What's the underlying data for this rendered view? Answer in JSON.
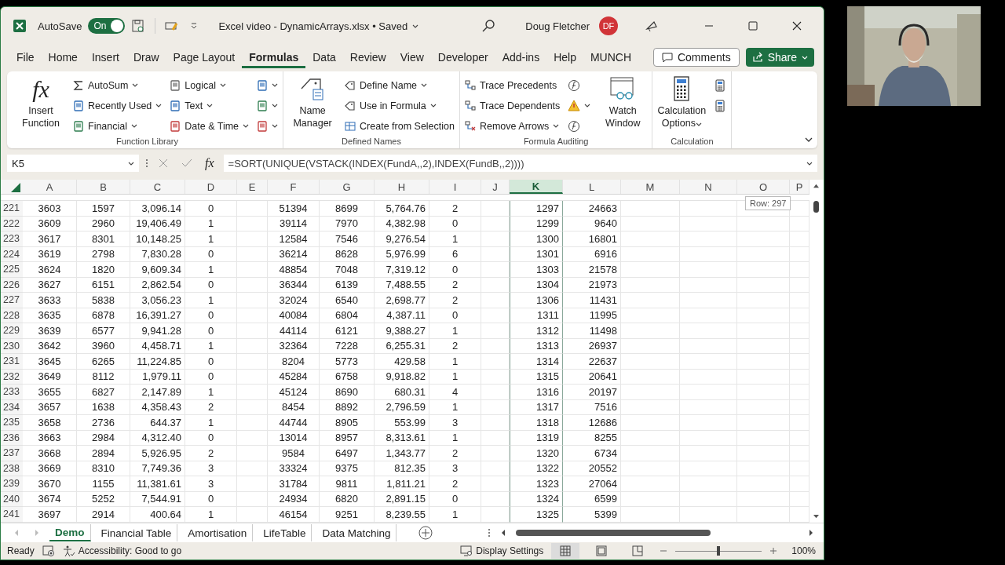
{
  "title_bar": {
    "autosave_label": "AutoSave",
    "autosave_on": true,
    "autosave_state": "On",
    "document_title": "Excel video - DynamicArrays.xlsx • Saved",
    "user_name": "Doug Fletcher",
    "user_initials": "DF"
  },
  "menu_tabs": [
    {
      "label": "File",
      "selected": false
    },
    {
      "label": "Home",
      "selected": false
    },
    {
      "label": "Insert",
      "selected": false
    },
    {
      "label": "Draw",
      "selected": false
    },
    {
      "label": "Page Layout",
      "selected": false
    },
    {
      "label": "Formulas",
      "selected": true
    },
    {
      "label": "Data",
      "selected": false
    },
    {
      "label": "Review",
      "selected": false
    },
    {
      "label": "View",
      "selected": false
    },
    {
      "label": "Developer",
      "selected": false
    },
    {
      "label": "Add-ins",
      "selected": false
    },
    {
      "label": "Help",
      "selected": false
    },
    {
      "label": "MUNCH",
      "selected": false
    }
  ],
  "comments_button": "Comments",
  "share_button": "Share",
  "ribbon": {
    "groups": [
      {
        "label": "Function Library",
        "items": [
          {
            "kind": "large",
            "label": "Insert Function",
            "icon_text": "fx",
            "dropdown": false
          },
          {
            "kind": "column",
            "buttons": [
              {
                "label": "AutoSum",
                "dropdown": true
              },
              {
                "label": "Recently Used",
                "dropdown": true
              },
              {
                "label": "Financial",
                "dropdown": true
              }
            ]
          },
          {
            "kind": "column",
            "buttons": [
              {
                "label": "Logical",
                "dropdown": true
              },
              {
                "label": "Text",
                "dropdown": true
              },
              {
                "label": "Date & Time",
                "dropdown": true
              }
            ]
          },
          {
            "kind": "column",
            "buttons": [
              {
                "dropdown": true
              },
              {
                "dropdown": true
              },
              {
                "dropdown": true
              }
            ]
          }
        ]
      },
      {
        "label": "Defined Names",
        "items": [
          {
            "kind": "large",
            "label": "Name Manager",
            "dropdown": false
          },
          {
            "kind": "column",
            "buttons": [
              {
                "label": "Define Name",
                "dropdown": true
              },
              {
                "label": "Use in Formula",
                "dropdown": true
              },
              {
                "label": "Create from Selection",
                "dropdown": false
              }
            ]
          }
        ]
      },
      {
        "label": "Formula Auditing",
        "items": [
          {
            "kind": "column",
            "buttons": [
              {
                "label": "Trace Precedents",
                "dropdown": false
              },
              {
                "label": "Trace Dependents",
                "dropdown": false
              },
              {
                "label": "Remove Arrows",
                "dropdown": true
              }
            ]
          },
          {
            "kind": "column",
            "buttons": [
              {
                "dropdown": false
              },
              {
                "dropdown": true
              },
              {
                "dropdown": false
              }
            ]
          },
          {
            "kind": "large",
            "label": "Watch Window",
            "dropdown": false
          }
        ]
      },
      {
        "label": "Calculation",
        "items": [
          {
            "kind": "large",
            "label": "Calculation Options",
            "dropdown": true
          },
          {
            "kind": "column",
            "buttons": [
              {
                "dropdown": false
              },
              {
                "dropdown": false
              }
            ]
          }
        ]
      }
    ]
  },
  "formula_bar": {
    "name_box": "K5",
    "fx_label": "fx",
    "formula": "=SORT(UNIQUE(VSTACK(INDEX(FundA,,2),INDEX(FundB,,2))))"
  },
  "sheet": {
    "columns": [
      {
        "label": "A",
        "kind": "center",
        "selected": false
      },
      {
        "label": "B",
        "kind": "center",
        "selected": false
      },
      {
        "label": "C",
        "kind": "right",
        "selected": false
      },
      {
        "label": "D",
        "kind": "center",
        "selected": false
      },
      {
        "label": "E",
        "kind": "empty",
        "selected": false
      },
      {
        "label": "F",
        "kind": "center",
        "selected": false
      },
      {
        "label": "G",
        "kind": "center",
        "selected": false
      },
      {
        "label": "H",
        "kind": "right",
        "selected": false
      },
      {
        "label": "I",
        "kind": "center",
        "selected": false
      },
      {
        "label": "J",
        "kind": "empty",
        "selected": false
      },
      {
        "label": "K",
        "kind": "right",
        "selected": true
      },
      {
        "label": "L",
        "kind": "right",
        "selected": false
      },
      {
        "label": "M",
        "kind": "empty",
        "selected": false
      },
      {
        "label": "N",
        "kind": "empty",
        "selected": false
      },
      {
        "label": "O",
        "kind": "empty",
        "selected": false
      },
      {
        "label": "P",
        "kind": "empty",
        "selected": false
      }
    ],
    "rows": [
      {
        "number": "221",
        "cells": [
          "3603",
          "1597",
          "3,096.14",
          "0",
          "",
          "51394",
          "8699",
          "5,764.76",
          "2",
          "",
          "1297",
          "24663",
          "",
          "",
          "",
          ""
        ]
      },
      {
        "number": "222",
        "cells": [
          "3609",
          "2960",
          "19,406.49",
          "1",
          "",
          "39114",
          "7970",
          "4,382.98",
          "0",
          "",
          "1299",
          "9640",
          "",
          "",
          "",
          ""
        ]
      },
      {
        "number": "223",
        "cells": [
          "3617",
          "8301",
          "10,148.25",
          "1",
          "",
          "12584",
          "7546",
          "9,276.54",
          "1",
          "",
          "1300",
          "16801",
          "",
          "",
          "",
          ""
        ]
      },
      {
        "number": "224",
        "cells": [
          "3619",
          "2798",
          "7,830.28",
          "0",
          "",
          "36214",
          "8628",
          "5,976.99",
          "6",
          "",
          "1301",
          "6916",
          "",
          "",
          "",
          ""
        ]
      },
      {
        "number": "225",
        "cells": [
          "3624",
          "1820",
          "9,609.34",
          "1",
          "",
          "48854",
          "7048",
          "7,319.12",
          "0",
          "",
          "1303",
          "21578",
          "",
          "",
          "",
          ""
        ]
      },
      {
        "number": "226",
        "cells": [
          "3627",
          "6151",
          "2,862.54",
          "0",
          "",
          "36344",
          "6139",
          "7,488.55",
          "2",
          "",
          "1304",
          "21973",
          "",
          "",
          "",
          ""
        ]
      },
      {
        "number": "227",
        "cells": [
          "3633",
          "5838",
          "3,056.23",
          "1",
          "",
          "32024",
          "6540",
          "2,698.77",
          "2",
          "",
          "1306",
          "11431",
          "",
          "",
          "",
          ""
        ]
      },
      {
        "number": "228",
        "cells": [
          "3635",
          "6878",
          "16,391.27",
          "0",
          "",
          "40084",
          "6804",
          "4,387.11",
          "0",
          "",
          "1311",
          "11995",
          "",
          "",
          "",
          ""
        ]
      },
      {
        "number": "229",
        "cells": [
          "3639",
          "6577",
          "9,941.28",
          "0",
          "",
          "44114",
          "6121",
          "9,388.27",
          "1",
          "",
          "1312",
          "11498",
          "",
          "",
          "",
          ""
        ]
      },
      {
        "number": "230",
        "cells": [
          "3642",
          "3960",
          "4,458.71",
          "1",
          "",
          "32364",
          "7228",
          "6,255.31",
          "2",
          "",
          "1313",
          "26937",
          "",
          "",
          "",
          ""
        ]
      },
      {
        "number": "231",
        "cells": [
          "3645",
          "6265",
          "11,224.85",
          "0",
          "",
          "8204",
          "5773",
          "429.58",
          "1",
          "",
          "1314",
          "22637",
          "",
          "",
          "",
          ""
        ]
      },
      {
        "number": "232",
        "cells": [
          "3649",
          "8112",
          "1,979.11",
          "0",
          "",
          "45284",
          "6758",
          "9,918.82",
          "1",
          "",
          "1315",
          "20641",
          "",
          "",
          "",
          ""
        ]
      },
      {
        "number": "233",
        "cells": [
          "3655",
          "6827",
          "2,147.89",
          "1",
          "",
          "45124",
          "8690",
          "680.31",
          "4",
          "",
          "1316",
          "20197",
          "",
          "",
          "",
          ""
        ]
      },
      {
        "number": "234",
        "cells": [
          "3657",
          "1638",
          "4,358.43",
          "2",
          "",
          "8454",
          "8892",
          "2,796.59",
          "1",
          "",
          "1317",
          "7516",
          "",
          "",
          "",
          ""
        ]
      },
      {
        "number": "235",
        "cells": [
          "3658",
          "2736",
          "644.37",
          "1",
          "",
          "44744",
          "8905",
          "553.99",
          "3",
          "",
          "1318",
          "12686",
          "",
          "",
          "",
          ""
        ]
      },
      {
        "number": "236",
        "cells": [
          "3663",
          "2984",
          "4,312.40",
          "0",
          "",
          "13014",
          "8957",
          "8,313.61",
          "1",
          "",
          "1319",
          "8255",
          "",
          "",
          "",
          ""
        ]
      },
      {
        "number": "237",
        "cells": [
          "3668",
          "2894",
          "5,926.95",
          "2",
          "",
          "9584",
          "6497",
          "1,343.77",
          "2",
          "",
          "1320",
          "6734",
          "",
          "",
          "",
          ""
        ]
      },
      {
        "number": "238",
        "cells": [
          "3669",
          "8310",
          "7,749.36",
          "3",
          "",
          "33324",
          "9375",
          "812.35",
          "3",
          "",
          "1322",
          "20552",
          "",
          "",
          "",
          ""
        ]
      },
      {
        "number": "239",
        "cells": [
          "3670",
          "1155",
          "11,381.61",
          "3",
          "",
          "31784",
          "9811",
          "1,811.21",
          "2",
          "",
          "1323",
          "27064",
          "",
          "",
          "",
          ""
        ]
      },
      {
        "number": "240",
        "cells": [
          "3674",
          "5252",
          "7,544.91",
          "0",
          "",
          "24934",
          "6820",
          "2,891.15",
          "0",
          "",
          "1324",
          "6599",
          "",
          "",
          "",
          ""
        ]
      },
      {
        "number": "241",
        "cells": [
          "3697",
          "2914",
          "400.64",
          "1",
          "",
          "46154",
          "9251",
          "8,239.55",
          "1",
          "",
          "1325",
          "5399",
          "",
          "",
          "",
          ""
        ]
      }
    ],
    "tooltip": "Row: 297"
  },
  "sheet_tabs": [
    {
      "label": "Demo",
      "selected": true
    },
    {
      "label": "Financial Table",
      "selected": false
    },
    {
      "label": "Amortisation",
      "selected": false
    },
    {
      "label": "LifeTable",
      "selected": false
    },
    {
      "label": "Data Matching",
      "selected": false
    }
  ],
  "status_bar": {
    "ready": "Ready",
    "accessibility": "Accessibility: Good to go",
    "display_settings": "Display Settings",
    "views": [
      {
        "selected": true
      },
      {
        "selected": false
      },
      {
        "selected": false
      }
    ],
    "zoom": {
      "level": 0.5,
      "label": "100%"
    }
  }
}
